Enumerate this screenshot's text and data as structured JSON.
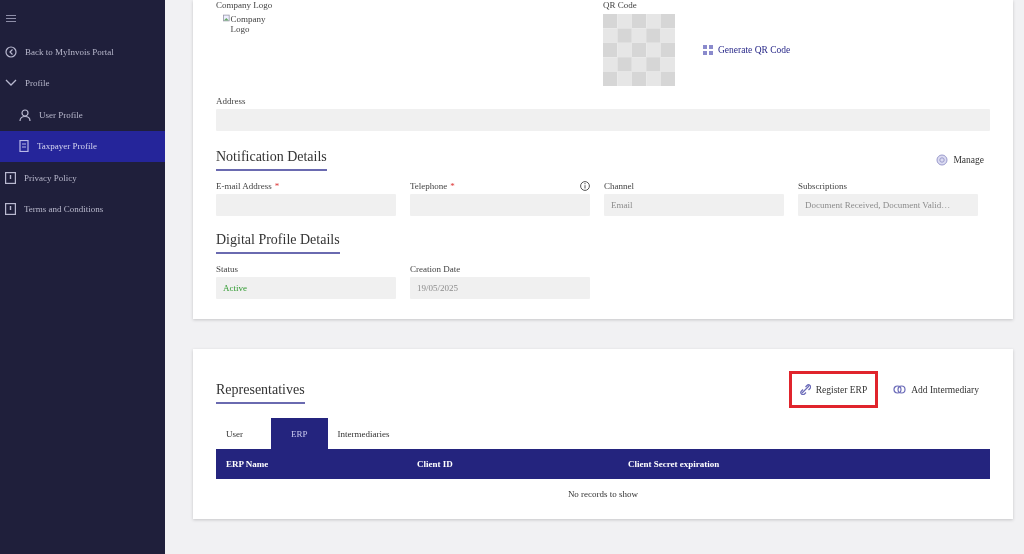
{
  "sidebar": {
    "items": [
      {
        "kind": "portal",
        "label": "Back to MyInvois Portal",
        "selected": false
      },
      {
        "kind": "group",
        "label": "Profile",
        "selected": false,
        "expanded": true,
        "children": [
          {
            "kind": "user",
            "label": "User Profile",
            "selected": false
          },
          {
            "kind": "taxpayer",
            "label": "Taxpayer Profile",
            "selected": true
          }
        ]
      },
      {
        "kind": "document",
        "label": "Privacy Policy",
        "selected": false
      },
      {
        "kind": "document",
        "label": "Terms and Conditions",
        "selected": false
      }
    ]
  },
  "profile": {
    "company_logo": {
      "label": "Company Logo",
      "alt": "Company Logo"
    },
    "qr_code": {
      "label": "QR Code",
      "action": "Generate QR Code"
    },
    "address": {
      "label": "Address"
    },
    "notification": {
      "title": "Notification Details",
      "action": "Manage",
      "fields": [
        {
          "label": "E-mail Address",
          "required_mark": "*",
          "info": false
        },
        {
          "label": "Telephone",
          "required_mark": "*",
          "info": true
        },
        {
          "label": "Channel",
          "info": false,
          "disabled": true,
          "value": "Email"
        },
        {
          "label": "Subscriptions",
          "info": false,
          "disabled": true,
          "value": "Document Received, Document Valid…"
        }
      ]
    },
    "digital": {
      "title": "Digital Profile Details",
      "fields": [
        {
          "label": "Status",
          "kind": "status",
          "disabled": false,
          "value": "Active"
        },
        {
          "label": "Creation Date",
          "kind": "text",
          "disabled": true,
          "value": "19/05/2025"
        }
      ]
    }
  },
  "representatives": {
    "title": "Representatives",
    "actions": [
      {
        "kind": "register",
        "label": "Register ERP",
        "highlighted": true
      },
      {
        "kind": "intermediary",
        "label": "Add Intermediary",
        "highlighted": false
      }
    ],
    "tabs": [
      {
        "label": "User",
        "selected": false
      },
      {
        "label": "ERP",
        "selected": true
      },
      {
        "label": "Intermediaries",
        "selected": false
      }
    ],
    "table": {
      "columns": [
        "ERP Name",
        "Client ID",
        "Client Secret expiration"
      ],
      "empty_text": "No records to show"
    }
  }
}
